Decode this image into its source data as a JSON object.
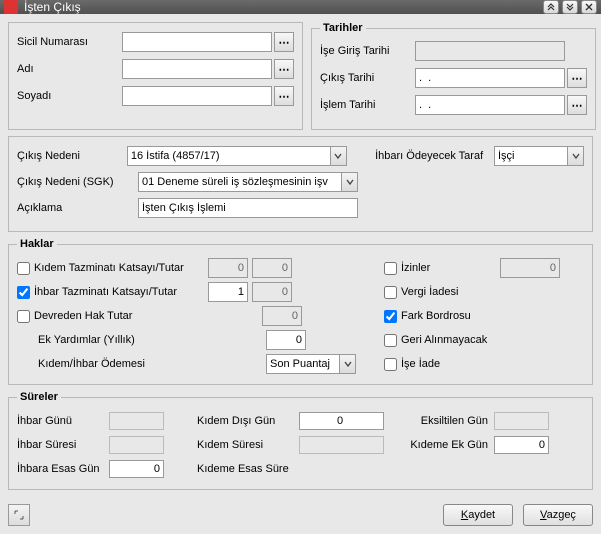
{
  "window": {
    "title": "İşten Çıkış"
  },
  "identity": {
    "sicil_label": "Sicil Numarası",
    "sicil_value": "",
    "adi_label": "Adı",
    "adi_value": "",
    "soyadi_label": "Soyadı",
    "soyadi_value": ""
  },
  "dates": {
    "legend": "Tarihler",
    "giris_label": "İşe Giriş Tarihi",
    "giris_value": "",
    "cikis_label": "Çıkış Tarihi",
    "cikis_value": ".  .",
    "islem_label": "İşlem Tarihi",
    "islem_value": ".  ."
  },
  "reason": {
    "neden_label": "Çıkış Nedeni",
    "neden_value": "16 İstifa (4857/17)",
    "sgk_label": "Çıkış Nedeni (SGK)",
    "sgk_value": "01 Deneme süreli iş sözleşmesinin işv",
    "aciklama_label": "Açıklama",
    "aciklama_value": "İşten Çıkış İşlemi",
    "ihbar_taraf_label": "İhbarı Ödeyecek Taraf",
    "ihbar_taraf_value": "İşçi"
  },
  "haklar": {
    "legend": "Haklar",
    "kidem_check": false,
    "kidem_label": "Kıdem Tazminatı Katsayı/Tutar",
    "kidem_v1": "0",
    "kidem_v2": "0",
    "ihbar_check": true,
    "ihbar_label": "İhbar Tazminatı Katsayı/Tutar",
    "ihbar_v1": "1",
    "ihbar_v2": "0",
    "devreden_check": false,
    "devreden_label": "Devreden Hak Tutar",
    "devreden_v": "0",
    "ekyardim_label": "Ek Yardımlar (Yıllık)",
    "ekyardim_v": "0",
    "kidemihbar_label": "Kıdem/İhbar Ödemesi",
    "kidemihbar_value": "Son Puantaj",
    "izinler_label": "İzinler",
    "izinler_check": false,
    "izinler_v": "0",
    "vergi_label": "Vergi İadesi",
    "vergi_check": false,
    "fark_label": "Fark Bordrosu",
    "fark_check": true,
    "geri_label": "Geri Alınmayacak",
    "geri_check": false,
    "iseiade_label": "İşe İade",
    "iseiade_check": false
  },
  "sureler": {
    "legend": "Süreler",
    "ihbar_gunu_label": "İhbar Günü",
    "ihbar_gunu_v": "",
    "ihbar_suresi_label": "İhbar Süresi",
    "ihbar_suresi_v": "",
    "ihbara_esas_label": "İhbara Esas Gün",
    "ihbara_esas_v": "0",
    "kidem_disi_label": "Kıdem Dışı Gün",
    "kidem_disi_v": "0",
    "kidem_suresi_label": "Kıdem Süresi",
    "kidem_suresi_v": "",
    "kideme_esas_label": "Kıdeme Esas Süre",
    "eksiltilen_label": "Eksiltilen Gün",
    "eksiltilen_v": "",
    "kidem_ek_label": "Kıdeme Ek Gün",
    "kidem_ek_v": "0"
  },
  "buttons": {
    "save": "Kaydet",
    "cancel": "Vazgeç"
  }
}
